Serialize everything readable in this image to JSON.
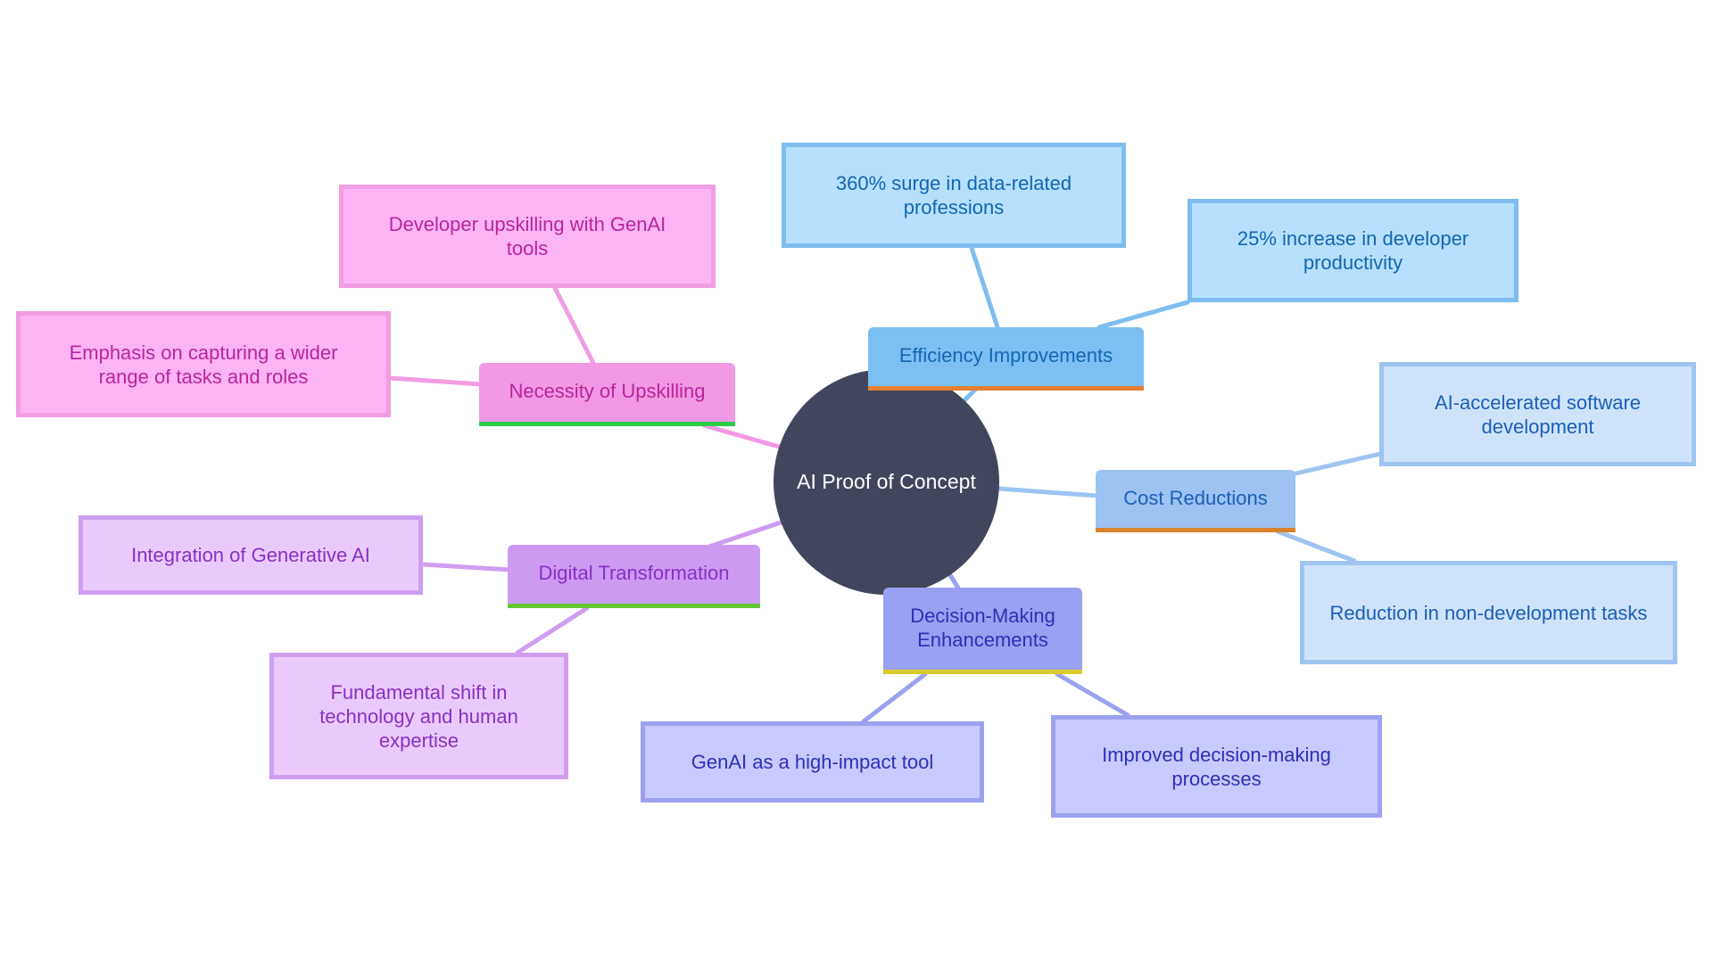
{
  "diagram": {
    "type": "mindmap",
    "root": {
      "label": "AI Proof of Concept",
      "color": "#41465c"
    },
    "branches": [
      {
        "id": "efficiency",
        "label": "Efficiency Improvements",
        "color": "#7cbff2",
        "accent": "#e57f31",
        "children": [
          {
            "label": "360% surge in data-related professions"
          },
          {
            "label": "25% increase in developer productivity"
          }
        ]
      },
      {
        "id": "cost",
        "label": "Cost Reductions",
        "color": "#9cc3f2",
        "accent": "#d9822b",
        "children": [
          {
            "label": "AI-accelerated software development"
          },
          {
            "label": "Reduction in non-development tasks"
          }
        ]
      },
      {
        "id": "decision",
        "label": "Decision-Making Enhancements",
        "color": "#9aa0f2",
        "accent": "#d8cc2c",
        "children": [
          {
            "label": "GenAI as a high-impact tool"
          },
          {
            "label": "Improved decision-making processes"
          }
        ]
      },
      {
        "id": "digital",
        "label": "Digital Transformation",
        "color": "#cd9af2",
        "accent": "#62c732",
        "children": [
          {
            "label": "Integration of Generative AI"
          },
          {
            "label": "Fundamental shift in technology and human expertise"
          }
        ]
      },
      {
        "id": "upskilling",
        "label": "Necessity of Upskilling",
        "color": "#f298e4",
        "accent": "#2ccb4a",
        "children": [
          {
            "label": "Developer upskilling with GenAI tools"
          },
          {
            "label": "Emphasis on capturing a wider range of tasks and roles"
          }
        ]
      }
    ]
  }
}
